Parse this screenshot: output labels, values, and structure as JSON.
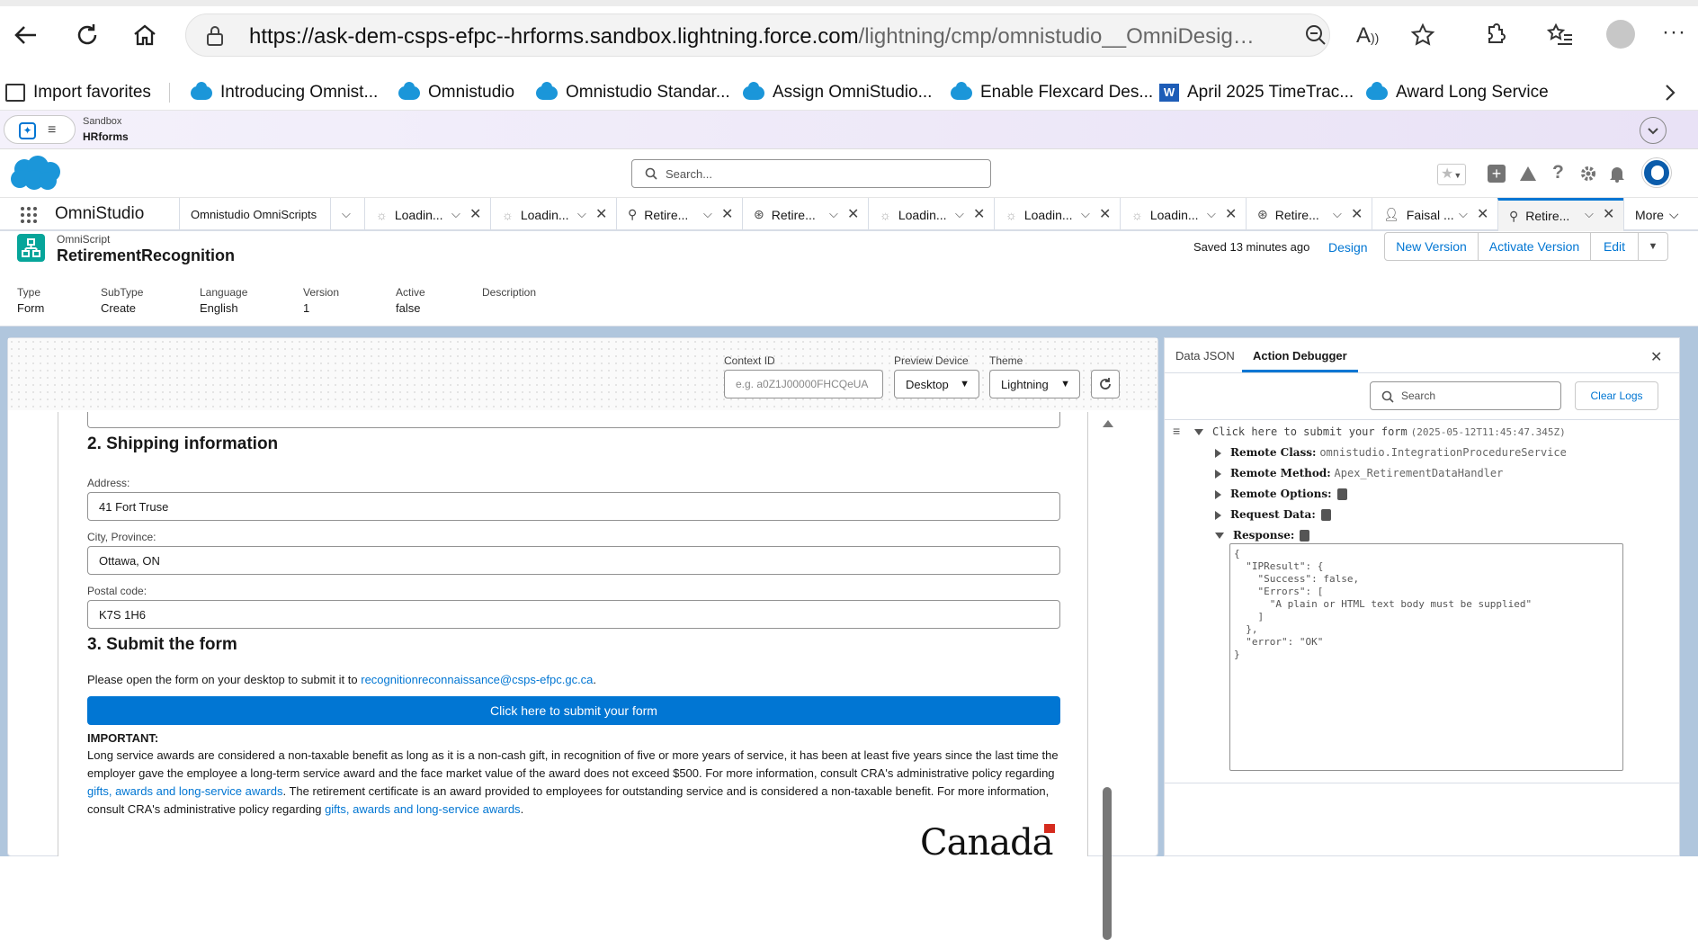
{
  "browser": {
    "url_host": "https://ask-dem-csps-efpc--hrforms.sandbox.lightning.force.com",
    "url_path": "/lightning/cmp/omnistudio__OmniDesignerAuraWrapper..."
  },
  "bookmarks": [
    {
      "label": "Import favorites",
      "icon": "import-icon"
    },
    {
      "label": "Introducing Omnist...",
      "icon": "salesforce-cloud-icon"
    },
    {
      "label": "Omnistudio",
      "icon": "salesforce-cloud-icon"
    },
    {
      "label": "Omnistudio Standar...",
      "icon": "salesforce-cloud-icon"
    },
    {
      "label": "Assign OmniStudio...",
      "icon": "salesforce-cloud-icon"
    },
    {
      "label": "Enable Flexcard Des...",
      "icon": "salesforce-cloud-icon"
    },
    {
      "label": "April 2025 TimeTrac...",
      "icon": "word-icon"
    },
    {
      "label": "Award Long Service",
      "icon": "salesforce-cloud-icon"
    }
  ],
  "sandbox": {
    "label": "Sandbox",
    "org": "HRforms"
  },
  "search": {
    "placeholder": "Search..."
  },
  "app": {
    "name": "OmniStudio"
  },
  "tabs": [
    {
      "label": "Omnistudio OmniScripts"
    },
    {
      "label": "Loadin..."
    },
    {
      "label": "Loadin..."
    },
    {
      "label": "Retire..."
    },
    {
      "label": "Retire..."
    },
    {
      "label": "Loadin..."
    },
    {
      "label": "Loadin..."
    },
    {
      "label": "Loadin..."
    },
    {
      "label": "Retire..."
    },
    {
      "label": "Faisal ..."
    },
    {
      "label": "Retire..."
    }
  ],
  "more_label": "More",
  "record": {
    "object": "OmniScript",
    "name": "RetirementRecognition",
    "saved": "Saved 13 minutes ago",
    "design": "Design",
    "new_version": "New Version",
    "activate_version": "Activate Version",
    "edit": "Edit",
    "fields": [
      {
        "label": "Type",
        "value": "Form"
      },
      {
        "label": "SubType",
        "value": "Create"
      },
      {
        "label": "Language",
        "value": "English"
      },
      {
        "label": "Version",
        "value": "1"
      },
      {
        "label": "Active",
        "value": "false"
      },
      {
        "label": "Description",
        "value": ""
      }
    ]
  },
  "preview": {
    "context_id_label": "Context ID",
    "context_id_placeholder": "e.g. a0Z1J00000FHCQeUA",
    "device_label": "Preview Device",
    "device_value": "Desktop",
    "theme_label": "Theme",
    "theme_value": "Lightning"
  },
  "form": {
    "section2_title": "2. Shipping information",
    "address_label": "Address:",
    "address_value": "41 Fort Truse",
    "city_label": "City, Province:",
    "city_value": "Ottawa, ON",
    "postal_label": "Postal code:",
    "postal_value": "K7S 1H6",
    "section3_title": "3. Submit the form",
    "submit_text_pre": "Please open the form on your desktop to submit it to",
    "submit_email": "recognitionreconnaissance@csps-efpc.gc.ca",
    "submit_text_post": ".",
    "submit_button": "Click here to submit your form",
    "important_label": "IMPORTANT:",
    "important_p1": "Long service awards are considered a non-taxable benefit as long as it is a non-cash gift, in recognition of five or more years of service, it has been at least five years since the last time the employer gave the employee a long-term service award and the face market value of the award does not exceed $500. For more information, consult CRA's administrative policy regarding",
    "link1": "gifts, awards and long-service awards",
    "important_p2": ".  The retirement certificate is an award provided to employees for outstanding service and is considered a non-taxable benefit. For more information, consult CRA's administrative policy regarding",
    "link2": "gifts, awards and long-service awards",
    "important_p3": ".",
    "wordmark": "Canada"
  },
  "debugger": {
    "tab_data_json": "Data JSON",
    "tab_action_debugger": "Action Debugger",
    "search_placeholder": "Search",
    "clear_logs": "Clear Logs",
    "entry_title": "Click here to submit your form",
    "entry_time": "(2025-05-12T11:45:47.345Z)",
    "remote_class_label": "Remote Class:",
    "remote_class_value": "omnistudio.IntegrationProcedureService",
    "remote_method_label": "Remote Method:",
    "remote_method_value": "Apex_RetirementDataHandler",
    "remote_options_label": "Remote Options:",
    "request_data_label": "Request Data:",
    "response_label": "Response:",
    "response_json": "{\n  \"IPResult\": {\n    \"Success\": false,\n    \"Errors\": [\n      \"A plain or HTML text body must be supplied\"\n    ]\n  },\n  \"error\": \"OK\"\n}"
  },
  "colors": {
    "brand_blue": "#0176d3",
    "salesforce_cloud": "#1b96d9",
    "canvas_bg": "#b0c6dd"
  }
}
